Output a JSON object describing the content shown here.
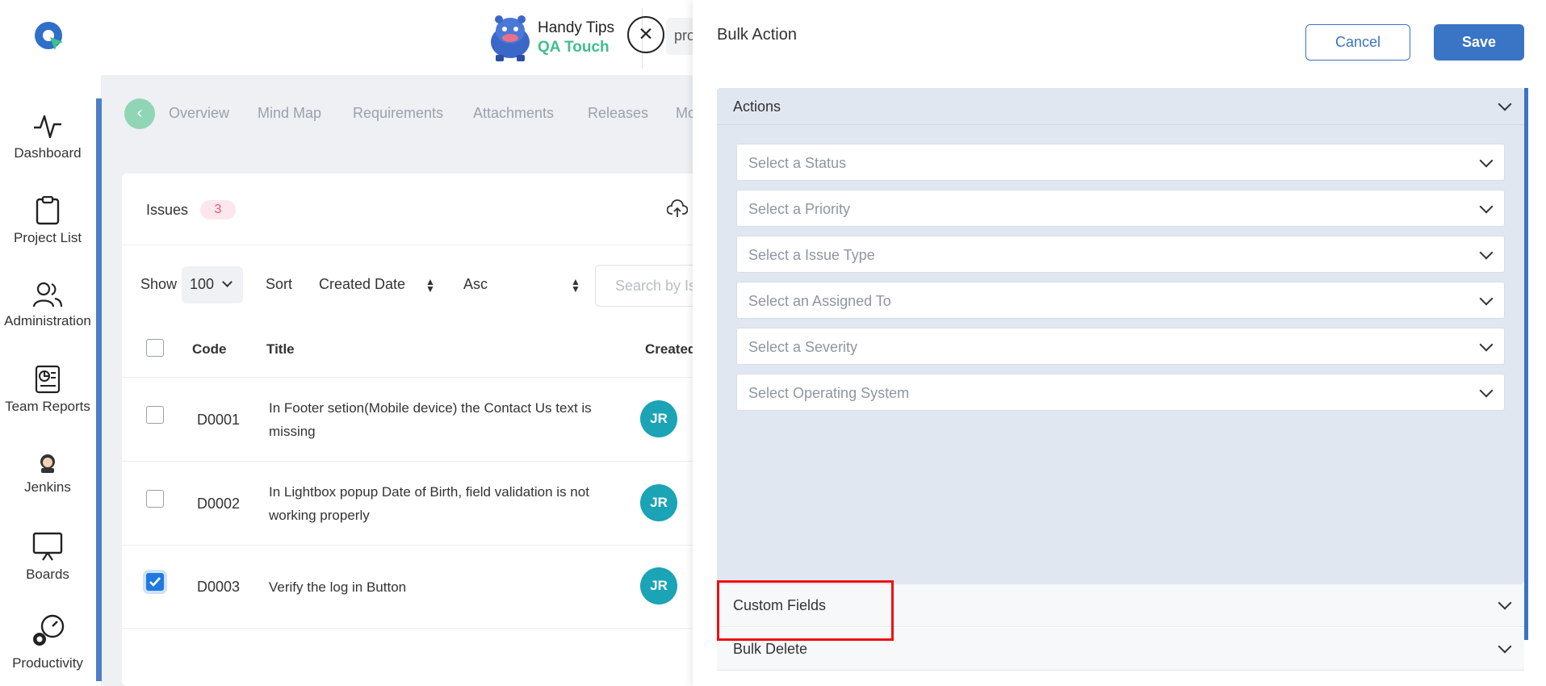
{
  "nav": {
    "items": [
      {
        "label": "Dashboard",
        "icon": "activity-icon"
      },
      {
        "label": "Project List",
        "icon": "clipboard-icon"
      },
      {
        "label": "Administration",
        "icon": "users-icon"
      },
      {
        "label": "Team Reports",
        "icon": "report-icon"
      },
      {
        "label": "Jenkins",
        "icon": "jenkins-icon"
      },
      {
        "label": "Boards",
        "icon": "board-icon"
      },
      {
        "label": "Productivity",
        "icon": "productivity-icon"
      }
    ]
  },
  "handy_tips": {
    "title": "Handy Tips",
    "subtitle": "QA Touch"
  },
  "top_input": {
    "value": "pro"
  },
  "tabs": [
    "Overview",
    "Mind Map",
    "Requirements",
    "Attachments",
    "Releases",
    "Mo"
  ],
  "issues": {
    "label": "Issues",
    "count": "3",
    "show_label": "Show",
    "show_value": "100",
    "sort_label": "Sort",
    "sort_field": "Created Date",
    "sort_order": "Asc",
    "search_placeholder": "Search by Is",
    "columns": {
      "code": "Code",
      "title": "Title",
      "created": "Created"
    },
    "rows": [
      {
        "code": "D0001",
        "title": "In Footer setion(Mobile device) the Contact Us text is missing",
        "avatar": "JR",
        "checked": false
      },
      {
        "code": "D0002",
        "title": "In Lightbox popup Date of Birth, field validation is not working properly",
        "avatar": "JR",
        "checked": false
      },
      {
        "code": "D0003",
        "title": "Verify the log in Button",
        "avatar": "JR",
        "checked": true
      }
    ]
  },
  "panel": {
    "title": "Bulk Action",
    "cancel_label": "Cancel",
    "save_label": "Save",
    "actions_label": "Actions",
    "selects": [
      "Select a Status",
      "Select a Priority",
      "Select a Issue Type",
      "Select an Assigned To",
      "Select a Severity",
      "Select Operating System"
    ],
    "custom_fields_label": "Custom Fields",
    "bulk_delete_label": "Bulk Delete"
  },
  "colors": {
    "accent": "#3a74c4",
    "badge": "#e25b7a",
    "avatar": "#1ba3b6",
    "highlight": "#ee1111"
  }
}
